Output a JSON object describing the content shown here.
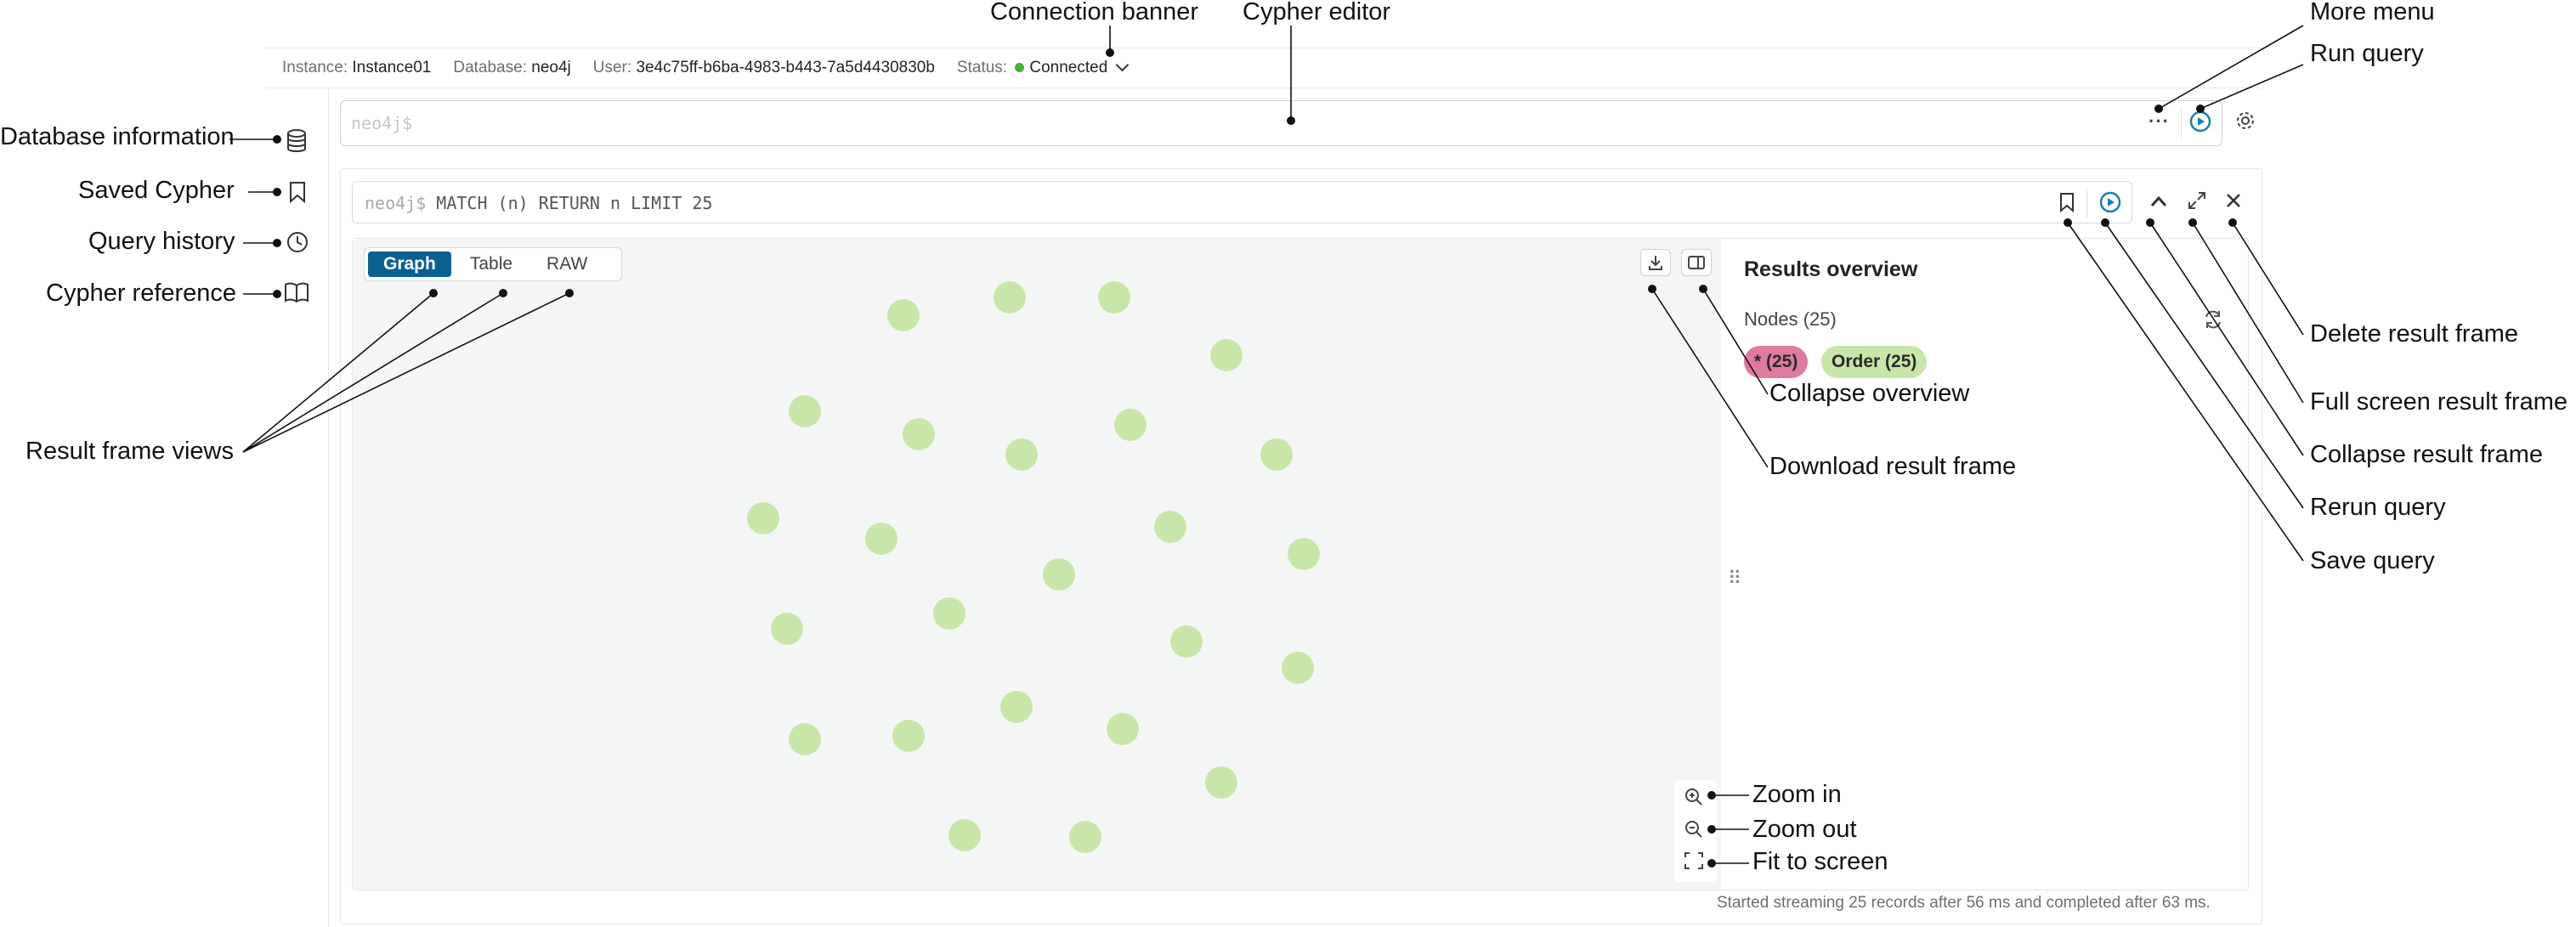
{
  "banner": {
    "instance_label": "Instance:",
    "instance_value": "Instance01",
    "database_label": "Database:",
    "database_value": "neo4j",
    "user_label": "User:",
    "user_value": "3e4c75ff-b6ba-4983-b443-7a5d4430830b",
    "status_label": "Status:",
    "status_value": "Connected"
  },
  "editor": {
    "placeholder": "neo4j$"
  },
  "frame": {
    "prompt": "neo4j$",
    "query": "MATCH (n) RETURN n LIMIT 25",
    "tabs": [
      {
        "label": "Graph",
        "active": true
      },
      {
        "label": "Table"
      },
      {
        "label": "RAW"
      }
    ],
    "overview": {
      "title": "Results overview",
      "nodes_count": "Nodes (25)",
      "labels": [
        {
          "text": "* (25)",
          "color": "#e07aa0"
        },
        {
          "text": "Order (25)",
          "color": "#c9e6a9"
        }
      ]
    },
    "footer": "Started streaming 25 records after 56 ms and completed after 63 ms."
  },
  "colors": {
    "accent": "#0a6190",
    "node": "#c9e6a9",
    "connected": "#4caf3a",
    "play": "#1a7fb0"
  },
  "icons": [
    "database-icon",
    "bookmark-icon",
    "history-icon",
    "book-icon",
    "more-icon",
    "play-icon",
    "gear-icon",
    "chevron-up-icon",
    "expand-icon",
    "close-icon",
    "download-icon",
    "panel-icon",
    "refresh-icon",
    "zoom-in-icon",
    "zoom-out-icon",
    "fit-screen-icon",
    "drag-handle-icon"
  ],
  "callouts": {
    "connection_banner": "Connection banner",
    "cypher_editor": "Cypher editor",
    "more_menu": "More menu",
    "run_query": "Run query",
    "database_information": "Database information",
    "saved_cypher": "Saved Cypher",
    "query_history": "Query history",
    "cypher_reference": "Cypher reference",
    "result_frame_views": "Result frame views",
    "delete_result_frame": "Delete result frame",
    "full_screen_result_frame": "Full screen result frame",
    "collapse_result_frame": "Collapse result frame",
    "rerun_query": "Rerun query",
    "save_query": "Save query",
    "collapse_overview": "Collapse overview",
    "download_result_frame": "Download result frame",
    "zoom_in": "Zoom in",
    "zoom_out": "Zoom out",
    "fit_to_screen": "Fit to screen"
  }
}
